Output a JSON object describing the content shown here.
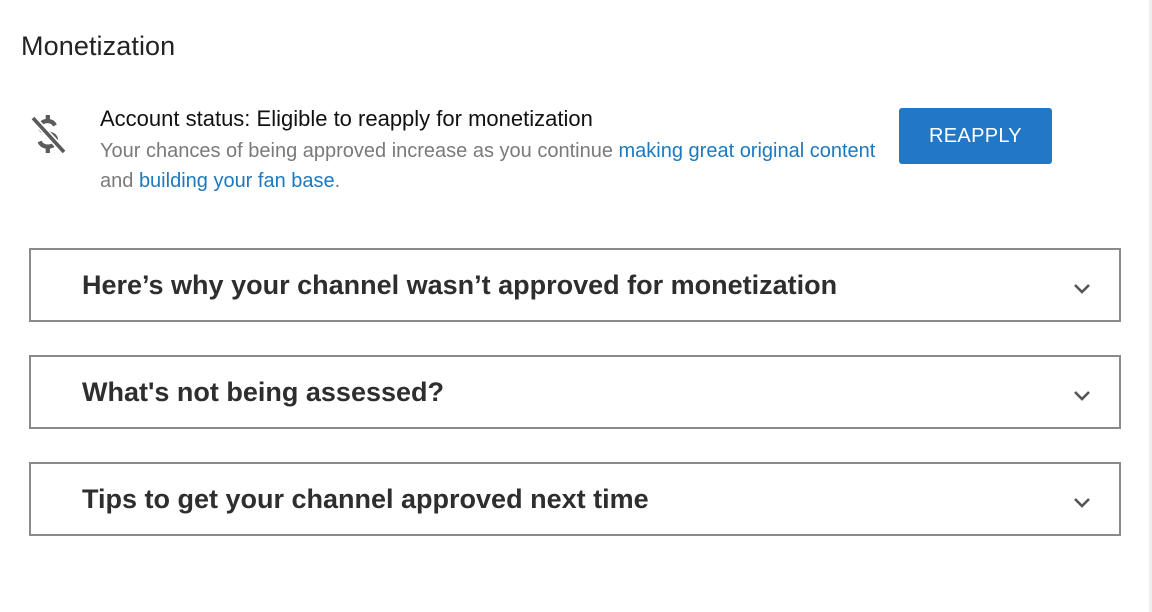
{
  "page": {
    "title": "Monetization"
  },
  "status": {
    "icon": "money-off-icon",
    "heading": "Account status: Eligible to reapply for monetization",
    "desc_prefix": "Your chances of being approved increase as you continue ",
    "link1": "making great original content",
    "desc_middle": " and ",
    "link2": "building your fan base",
    "desc_suffix": ".",
    "link_color": "#1c79c0"
  },
  "reapply_button": {
    "label": "REAPPLY",
    "color": "#2178c6"
  },
  "panels": [
    {
      "title": "Here’s why your channel wasn’t approved for monetization",
      "icon": "chevron-down-icon"
    },
    {
      "title": "What's not being assessed?",
      "icon": "chevron-down-icon"
    },
    {
      "title": "Tips to get your channel approved next time",
      "icon": "chevron-down-icon"
    }
  ]
}
